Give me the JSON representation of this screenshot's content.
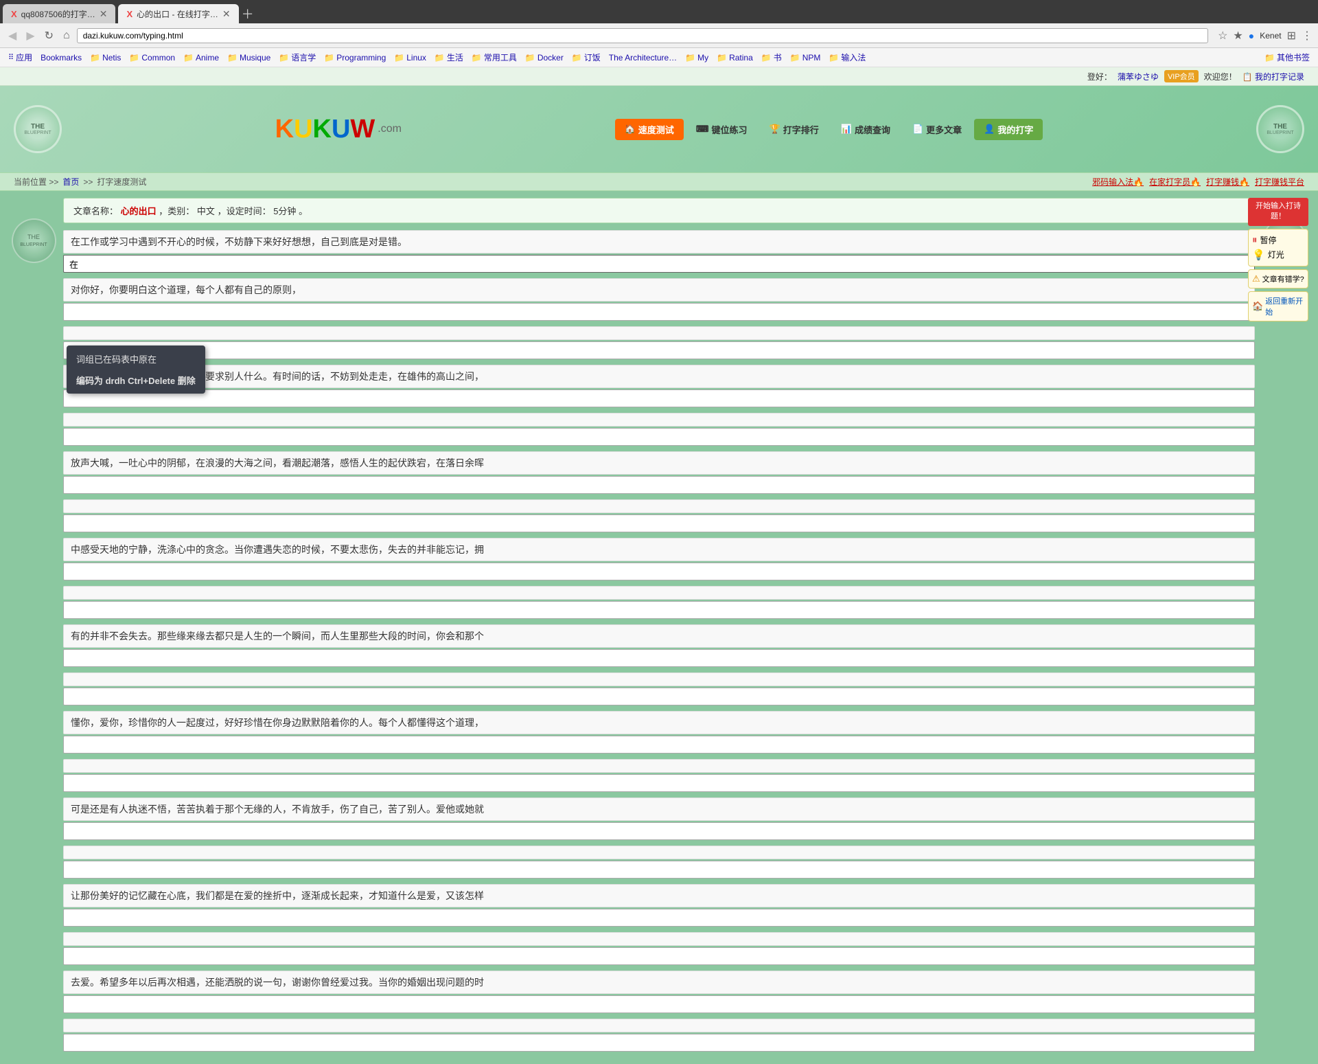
{
  "browser": {
    "tabs": [
      {
        "id": "tab1",
        "title": "qq8087506的打字…",
        "active": false,
        "favicon": "X"
      },
      {
        "id": "tab2",
        "title": "心的出口 - 在线打字…",
        "active": true,
        "favicon": "X"
      }
    ],
    "address": "dazi.kukuw.com/typing.html",
    "user_label": "Kenet",
    "bookmarks": [
      {
        "label": "应用"
      },
      {
        "label": "Bookmarks"
      },
      {
        "label": "Netis"
      },
      {
        "label": "Common"
      },
      {
        "label": "Anime"
      },
      {
        "label": "Musique"
      },
      {
        "label": "语言学"
      },
      {
        "label": "Programming"
      },
      {
        "label": "Linux"
      },
      {
        "label": "生活"
      },
      {
        "label": "常用工具"
      },
      {
        "label": "Docker"
      },
      {
        "label": "订饭"
      },
      {
        "label": "The Architecture…"
      },
      {
        "label": "My"
      },
      {
        "label": "Ratina"
      },
      {
        "label": "书"
      },
      {
        "label": "NPM"
      },
      {
        "label": "输入法"
      },
      {
        "label": "其他书签"
      }
    ]
  },
  "login_bar": {
    "login_prompt": "登好：",
    "username": "蒲苯ゆさゆ",
    "vip_badge": "VIP会员",
    "welcome": "欢迎您！",
    "my_records": "我的打字记录"
  },
  "site_header": {
    "logo_parts": [
      "K",
      "U",
      "K",
      "U",
      "W"
    ],
    "logo_com": ".com",
    "nav_items": [
      {
        "id": "speed-test",
        "label": "速度测试",
        "icon": "🏠",
        "active": true
      },
      {
        "id": "keyboard-practice",
        "label": "键位练习",
        "icon": "⌨️",
        "active": false
      },
      {
        "id": "typing-rank",
        "label": "打字排行",
        "icon": "🏆",
        "active": false
      },
      {
        "id": "score-query",
        "label": "成绩查询",
        "icon": "📊",
        "active": false
      },
      {
        "id": "more-articles",
        "label": "更多文章",
        "icon": "📄",
        "active": false
      },
      {
        "id": "my-typing",
        "label": "我的打字",
        "icon": "👤",
        "active": false
      }
    ]
  },
  "breadcrumb": {
    "path": "当前位置 >> 首页 >> 打字速度测试",
    "home": "首页",
    "current": "打字速度测试",
    "links": [
      {
        "label": "邪码输入法🔥",
        "color": "red"
      },
      {
        "label": "在家打字员🔥",
        "color": "red"
      },
      {
        "label": "打字赚钱🔥",
        "color": "red"
      },
      {
        "label": "打字赚钱平台",
        "color": "red"
      }
    ]
  },
  "article_info": {
    "label_name": "文章名称：",
    "title": "心的出口",
    "label_type": "，类别：",
    "type": "中文",
    "label_time": "，设定时间：",
    "time": "5分钟",
    "suffix": "。"
  },
  "controls": {
    "start_typing_label": "开始输入打诗题！",
    "pause_label": "暂停",
    "light_label": "灯光",
    "study_label": "文章有错学?",
    "restart_label": "返回重新开始"
  },
  "context_menu": {
    "item1": "词组已在码表中原在",
    "item2": "编码为 drdh Ctrl+Delete 删除"
  },
  "typing": {
    "current_input": "在",
    "paragraphs": [
      {
        "text": "在工作或学习中遇到不开心的时候，不妨静下来好好想想，自己到底是对是错。",
        "input": "在"
      },
      {
        "text": "对你好，你要明白这个道理，每个人都有自己的原则，",
        "input": ""
      },
      {
        "text": "",
        "input": ""
      },
      {
        "text": "有人功利，有人善良，你不可能要求别人什么。有时间的话，不妨到处走走，在雄伟的高山之间，",
        "input": ""
      },
      {
        "text": "",
        "input": ""
      },
      {
        "text": "放声大喊，一吐心中的阴郁，在浪漫的大海之间，看潮起潮落，感悟人生的起伏跌宕，在落日余晖",
        "input": ""
      },
      {
        "text": "",
        "input": ""
      },
      {
        "text": "中感受天地的宁静，洗涤心中的贪念。当你遭遇失恋的时候，不要太悲伤，失去的并非能忘记，拥",
        "input": ""
      },
      {
        "text": "",
        "input": ""
      },
      {
        "text": "有的并非不会失去。那些缘来缘去都只是人生的一个瞬间，而人生里那些大段的时间，你会和那个",
        "input": ""
      },
      {
        "text": "",
        "input": ""
      },
      {
        "text": "懂你，爱你，珍惜你的人一起度过，好好珍惜在你身边默默陪着你的人。每个人都懂得这个道理，",
        "input": ""
      },
      {
        "text": "",
        "input": ""
      },
      {
        "text": "可是还是有人执迷不悟，苦苦执着于那个无缘的人，不肯放手，伤了自己，苦了别人。爱他或她就",
        "input": ""
      },
      {
        "text": "",
        "input": ""
      },
      {
        "text": "让那份美好的记忆藏在心底，我们都是在爱的挫折中，逐渐成长起来，才知道什么是爱，又该怎样",
        "input": ""
      },
      {
        "text": "",
        "input": ""
      },
      {
        "text": "去爱。希望多年以后再次相遇，还能洒脱的说一句，谢谢你曾经爱过我。当你的婚姻出现问题的时",
        "input": ""
      },
      {
        "text": "",
        "input": ""
      }
    ]
  },
  "decoration": {
    "flower_text": "THE",
    "flower_subtitle": "BLUEPRINT"
  }
}
